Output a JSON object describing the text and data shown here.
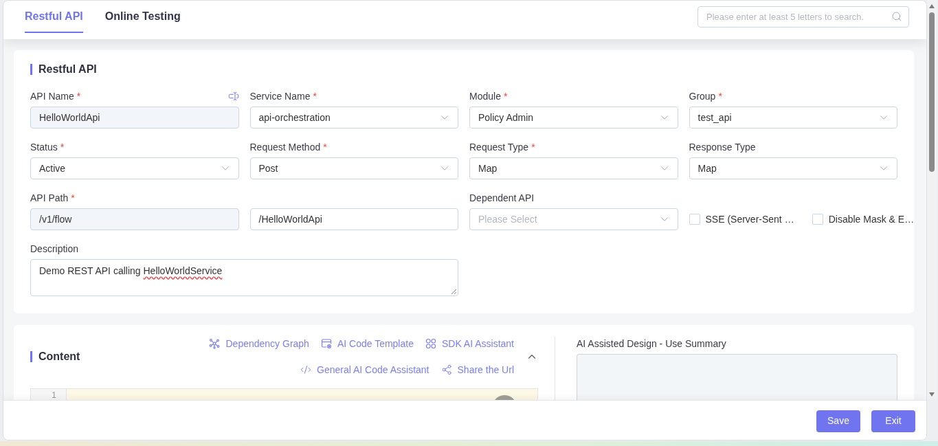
{
  "tabs": [
    {
      "label": "Restful API",
      "selected": true
    },
    {
      "label": "Online Testing",
      "selected": false
    }
  ],
  "search": {
    "placeholder": "Please enter at least 5 letters to search."
  },
  "form_card": {
    "title": "Restful API",
    "rows": [
      [
        {
          "kind": "input",
          "label": "API Name",
          "required_mark": "*",
          "label_icon": true,
          "value": "HelloWorldApi",
          "readonly": true
        },
        {
          "kind": "select",
          "label": "Service Name",
          "required_mark": "*",
          "value": "api-orchestration"
        },
        {
          "kind": "select",
          "label": "Module",
          "required_mark": "*",
          "value": "Policy Admin"
        },
        {
          "kind": "select",
          "label": "Group",
          "required_mark": "*",
          "value": "test_api"
        }
      ],
      [
        {
          "kind": "select",
          "label": "Status",
          "required_mark": "*",
          "value": "Active"
        },
        {
          "kind": "select",
          "label": "Request Method",
          "required_mark": "*",
          "value": "Post"
        },
        {
          "kind": "select",
          "label": "Request Type",
          "required_mark": "*",
          "value": "Map"
        },
        {
          "kind": "select",
          "label": "Response Type",
          "value": "Map"
        }
      ],
      [
        {
          "kind": "input",
          "label": "API Path",
          "required_mark": "*",
          "value": "/v1/flow",
          "readonly": true
        },
        {
          "kind": "input",
          "value": "/HelloWorldApi",
          "readonly": false
        },
        {
          "kind": "select",
          "label": "Dependent API",
          "placeholder": "Please Select"
        },
        {
          "kind": "checkboxes",
          "items": [
            {
              "label": "SSE (Server-Sent …",
              "checked": false
            },
            {
              "label": "Disable Mask & E…",
              "checked": false
            }
          ]
        }
      ],
      [
        {
          "kind": "textarea",
          "label": "Description",
          "wide": true,
          "value_segments": [
            {
              "text": "Demo REST API calling",
              "misspelled": false
            },
            {
              "text": "HelloWorldService",
              "misspelled": true
            }
          ]
        }
      ]
    ]
  },
  "content_card": {
    "title": "Content",
    "expanded": true,
    "action_rows": [
      [
        {
          "label": "Dependency Graph"
        },
        {
          "label": "AI Code Template"
        },
        {
          "label": "SDK AI Assistant"
        }
      ],
      [
        {
          "label": "General AI Code Assistant"
        },
        {
          "label": "Share the Url"
        }
      ]
    ],
    "editor": {
      "line_numbers": [
        "1"
      ]
    },
    "summary": {
      "label": "AI Assisted Design - Use Summary"
    }
  },
  "footer": {
    "buttons": [
      "Save",
      "Exit"
    ]
  }
}
